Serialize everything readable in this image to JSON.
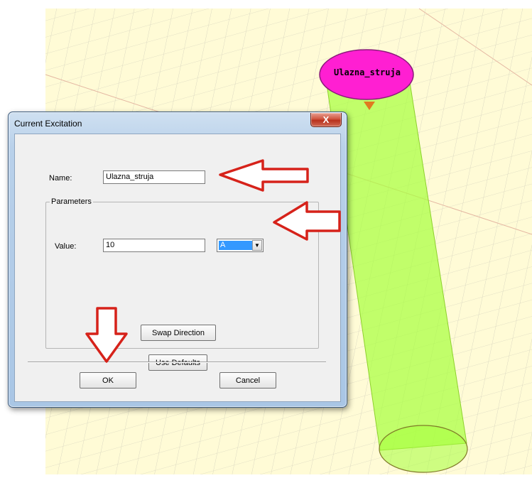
{
  "viewport": {
    "object_label": "Ulazna_struja",
    "colors": {
      "grid_bg": "#fffbd6",
      "grid_line": "#c8c7b2",
      "cylinder": "#a6ff3c",
      "port": "#ff1fd2"
    }
  },
  "dialog": {
    "title": "Current Excitation",
    "close_glyph": "X",
    "name_label": "Name:",
    "name_value": "Ulazna_struja",
    "parameters_label": "Parameters",
    "value_label": "Value:",
    "value_value": "10",
    "unit_selected": "A",
    "dropdown_glyph": "▼",
    "swap_direction_label": "Swap Direction",
    "use_defaults_label": "Use Defaults",
    "ok_label": "OK",
    "cancel_label": "Cancel"
  },
  "annotations": {
    "arrow_color": "#d6221a",
    "arrow_icons": [
      "arrow-left-icon",
      "arrow-left-icon",
      "arrow-down-icon"
    ]
  }
}
